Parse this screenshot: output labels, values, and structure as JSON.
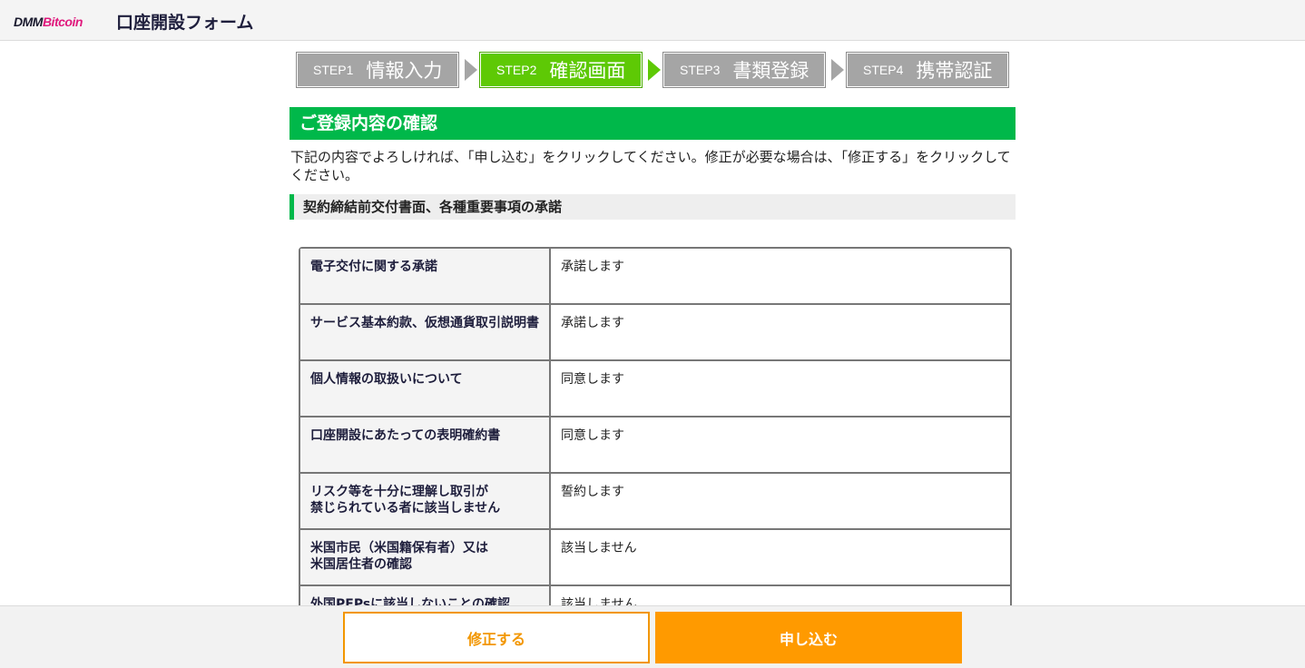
{
  "header": {
    "logo_part1": "DMM",
    "logo_part2": "Bitcoin",
    "title": "口座開設フォーム"
  },
  "steps": [
    {
      "no": "STEP1",
      "label": "情報入力",
      "active": false
    },
    {
      "no": "STEP2",
      "label": "確認画面",
      "active": true
    },
    {
      "no": "STEP3",
      "label": "書類登録",
      "active": false
    },
    {
      "no": "STEP4",
      "label": "携帯認証",
      "active": false
    }
  ],
  "section": {
    "title": "ご登録内容の確認",
    "intro": "下記の内容でよろしければ、「申し込む」をクリックしてください。修正が必要な場合は、「修正する」をクリックしてください。",
    "sub_heading": "契約締結前交付書面、各種重要事項の承諾"
  },
  "rows": [
    {
      "label": "電子交付に関する承諾",
      "value": "承諾します"
    },
    {
      "label": "サービス基本約款、仮想通貨取引説明書",
      "value": "承諾します"
    },
    {
      "label": "個人情報の取扱いについて",
      "value": "同意します"
    },
    {
      "label": "口座開設にあたっての表明確約書",
      "value": "同意します"
    },
    {
      "label": "リスク等を十分に理解し取引が\n禁じられている者に該当しません",
      "value": "誓約します"
    },
    {
      "label": "米国市民（米国籍保有者）又は\n米国居住者の確認",
      "value": "該当しません"
    },
    {
      "label": "外国PEPsに該当しないことの確認",
      "value": "該当しません"
    }
  ],
  "footer": {
    "edit_label": "修正する",
    "submit_label": "申し込む"
  },
  "colors": {
    "brand_green": "#00b84a",
    "active_step": "#5ec905",
    "inactive_step": "#a5a5a5",
    "accent_orange": "#ff9a00",
    "logo_pink": "#e0197d"
  }
}
